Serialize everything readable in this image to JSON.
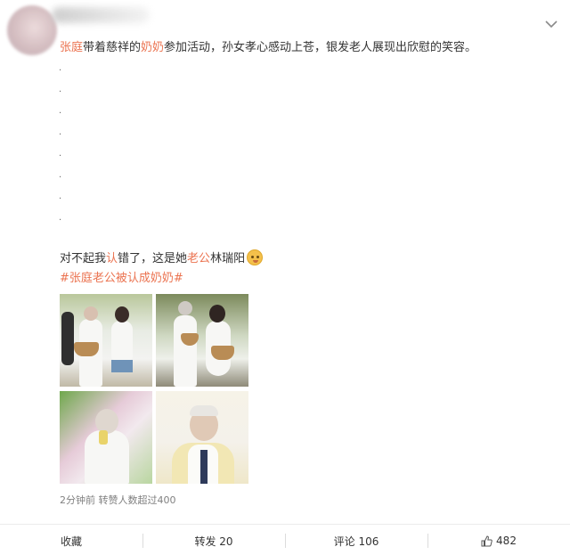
{
  "post": {
    "text_segments": [
      {
        "text": "张庭",
        "highlight": true
      },
      {
        "text": "带着慈祥的",
        "highlight": false
      },
      {
        "text": "奶奶",
        "highlight": true
      },
      {
        "text": "参加活动，孙女孝心感动上苍，银发老人展现出欣慰的笑容。",
        "highlight": false
      }
    ],
    "dots": [
      ".",
      ".",
      ".",
      ".",
      ".",
      ".",
      ".",
      "."
    ],
    "line2_segments": [
      {
        "text": "对不起我",
        "highlight": false
      },
      {
        "text": "认",
        "highlight": true
      },
      {
        "text": "错了，这是她",
        "highlight": false
      },
      {
        "text": "老公",
        "highlight": true
      },
      {
        "text": "林瑞阳",
        "highlight": false
      }
    ],
    "topic": "#张庭老公被认成奶奶#",
    "meta": "2分钟前 转赞人数超过400"
  },
  "actions": {
    "favorite": "收藏",
    "repost": "转发 20",
    "comment": "评论 106",
    "like": "482"
  },
  "colors": {
    "highlight": "#eb7350",
    "text": "#333333",
    "meta": "#808080"
  },
  "icons": {
    "more": "chevron-down-icon",
    "like": "thumbs-up-icon",
    "emoji": "emoji-icon"
  }
}
